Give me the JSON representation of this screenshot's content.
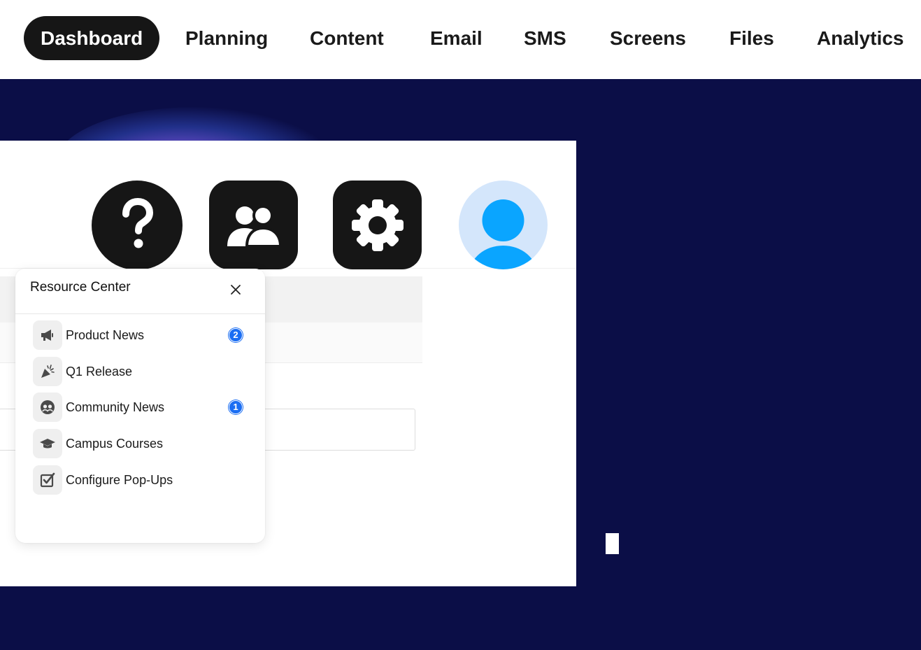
{
  "nav": {
    "items": [
      {
        "label": "Dashboard",
        "active": true
      },
      {
        "label": "Planning"
      },
      {
        "label": "Content"
      },
      {
        "label": "Email"
      },
      {
        "label": "SMS"
      },
      {
        "label": "Screens"
      },
      {
        "label": "Files"
      },
      {
        "label": "Analytics"
      }
    ]
  },
  "header_icons": [
    "question-mark-icon",
    "users-icon",
    "gear-icon",
    "user-avatar-icon"
  ],
  "resource_center": {
    "title": "Resource Center",
    "items": [
      {
        "label": "Product News",
        "icon": "megaphone-icon",
        "badge": "2"
      },
      {
        "label": "Q1 Release",
        "icon": "party-popper-icon"
      },
      {
        "label": "Community News",
        "icon": "community-icon",
        "badge": "1"
      },
      {
        "label": "Campus Courses",
        "icon": "graduation-cap-icon"
      },
      {
        "label": "Configure Pop-Ups",
        "icon": "checkbox-edit-icon"
      }
    ]
  },
  "colors": {
    "background": "#0b0e47",
    "nav_active_bg": "#161616",
    "badge": "#1b6ef3",
    "avatar_bg": "#d4e6fb",
    "avatar_fg": "#0aa5ff"
  }
}
